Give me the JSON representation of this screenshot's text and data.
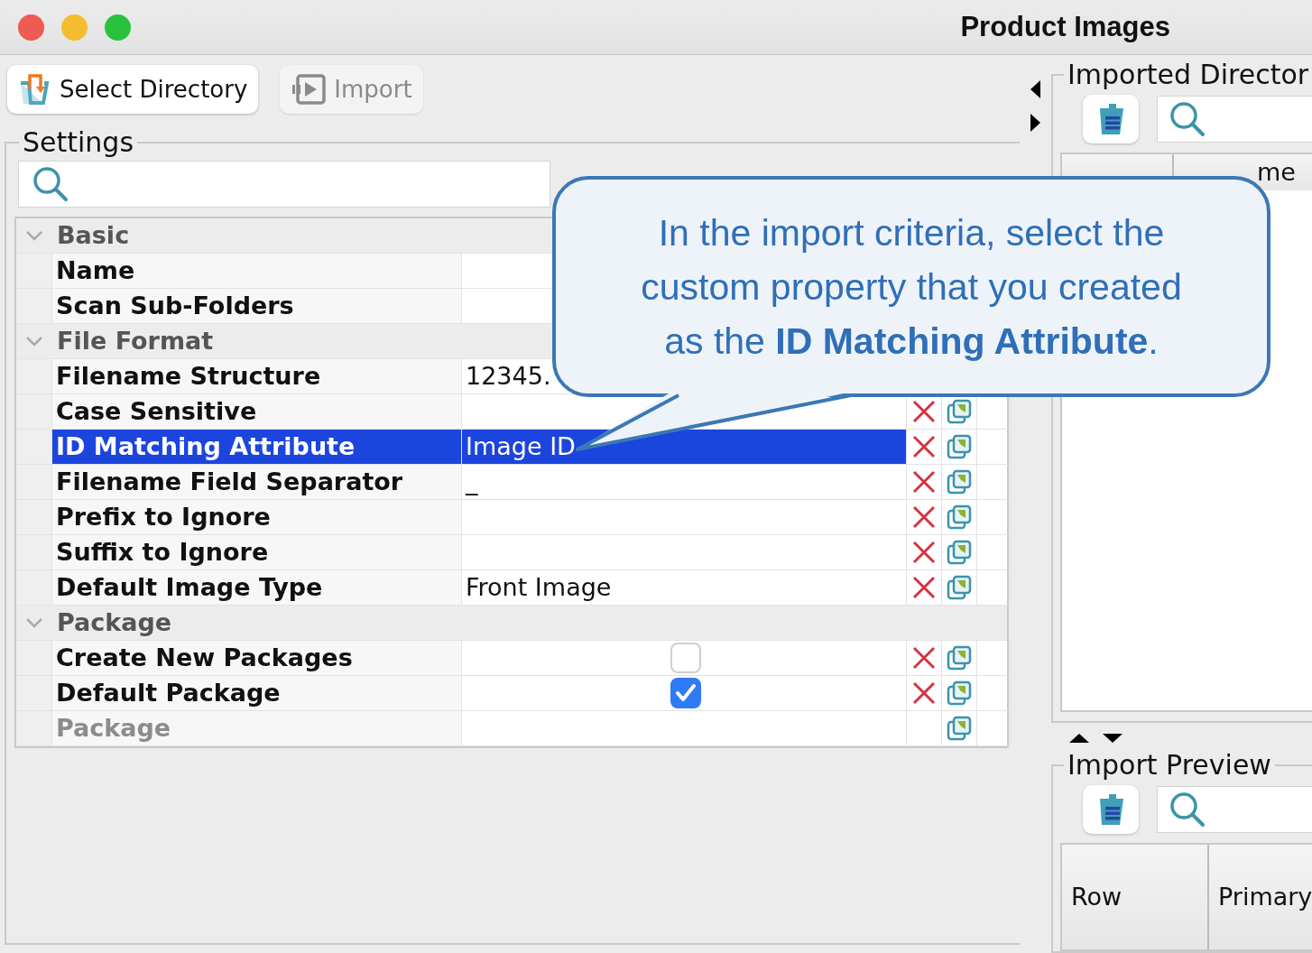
{
  "window": {
    "title": "Product Images"
  },
  "toolbar": [
    {
      "label": "Select Directory",
      "disabled": false
    },
    {
      "label": "Import",
      "disabled": true
    }
  ],
  "settings": {
    "title": "Settings",
    "groups": [
      {
        "title": "Basic",
        "expanded": true,
        "rows": [
          {
            "name": "Name",
            "kind": "text",
            "selected": false,
            "disabled": false,
            "removable": false,
            "copyable": false
          },
          {
            "name": "Scan Sub-Folders",
            "kind": "text",
            "selected": false,
            "disabled": false,
            "removable": false,
            "copyable": false
          }
        ]
      },
      {
        "title": "File Format",
        "expanded": true,
        "rows": [
          {
            "name": "Filename Structure",
            "kind": "text",
            "value": "12345.",
            "selected": false,
            "disabled": false,
            "removable": false,
            "copyable": false
          },
          {
            "name": "Case Sensitive",
            "kind": "text",
            "selected": false,
            "disabled": false,
            "removable": true,
            "copyable": true
          },
          {
            "name": "ID Matching Attribute",
            "kind": "text",
            "value": "Image ID",
            "selected": true,
            "disabled": false,
            "removable": true,
            "copyable": true
          },
          {
            "name": "Filename Field Separator",
            "kind": "text",
            "value": "_",
            "selected": false,
            "disabled": false,
            "removable": true,
            "copyable": true
          },
          {
            "name": "Prefix to Ignore",
            "kind": "text",
            "selected": false,
            "disabled": false,
            "removable": true,
            "copyable": true
          },
          {
            "name": "Suffix to Ignore",
            "kind": "text",
            "selected": false,
            "disabled": false,
            "removable": true,
            "copyable": true
          },
          {
            "name": "Default Image Type",
            "kind": "text",
            "value": "Front Image",
            "selected": false,
            "disabled": false,
            "removable": true,
            "copyable": true
          }
        ]
      },
      {
        "title": "Package",
        "expanded": true,
        "rows": [
          {
            "name": "Create New Packages",
            "kind": "checkbox",
            "checked": false,
            "selected": false,
            "disabled": false,
            "removable": true,
            "copyable": true
          },
          {
            "name": "Default Package",
            "kind": "checkbox",
            "checked": true,
            "selected": false,
            "disabled": false,
            "removable": true,
            "copyable": true
          },
          {
            "name": "Package",
            "kind": "text",
            "selected": false,
            "disabled": true,
            "removable": false,
            "copyable": true
          }
        ]
      }
    ]
  },
  "imported_directories": {
    "title": "Imported Director",
    "columns": [
      "me"
    ]
  },
  "import_preview": {
    "title": "Import Preview",
    "columns": [
      "Row",
      "Primary"
    ]
  },
  "callout": {
    "text": "In the import criteria, select the custom property that you created as the **ID Matching Attribute**."
  }
}
